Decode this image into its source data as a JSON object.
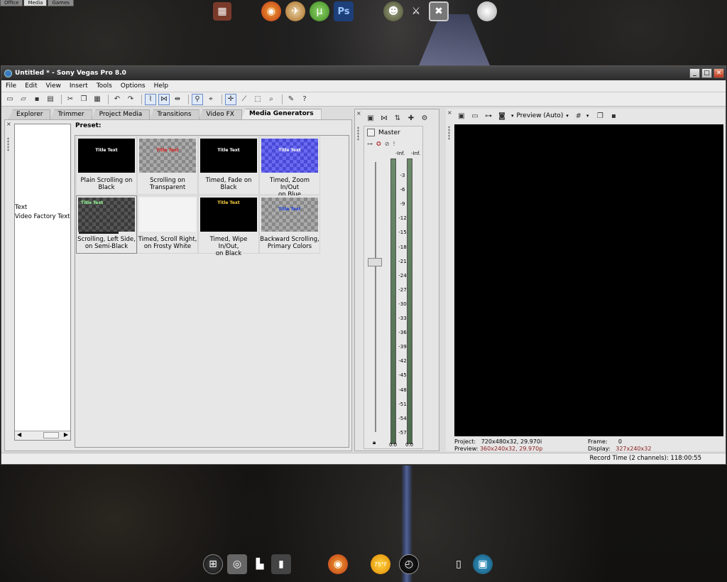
{
  "desktop": {
    "top_tabs": [
      "Office",
      "Media",
      "Games"
    ],
    "active_top_tab": "Media",
    "top_dock_icons": [
      "paint-icon",
      "firefox-icon",
      "ftp-icon",
      "utorrent-icon",
      "photoshop-icon",
      "halo-icon",
      "sword-icon",
      "x-game-icon",
      "moon-icon"
    ],
    "bottom_dock_icons": [
      "windows-start-icon",
      "webcam-icon",
      "boot-icon",
      "pc-icon",
      "firefox-icon",
      "weather-icon",
      "clock-icon",
      "phone-icon",
      "monitor-icon"
    ],
    "weather_temp": "75°F"
  },
  "window": {
    "title": "Untitled * - Sony Vegas Pro 8.0",
    "minimize": "_",
    "maximize": "□",
    "close": "✕"
  },
  "menu": [
    "File",
    "Edit",
    "View",
    "Insert",
    "Tools",
    "Options",
    "Help"
  ],
  "left_panel": {
    "tabs": [
      "Explorer",
      "Trimmer",
      "Project Media",
      "Transitions",
      "Video FX",
      "Media Generators"
    ],
    "active_tab": "Media Generators",
    "tree_items": [
      "Text",
      "Video Factory Text"
    ],
    "preset_label": "Preset:",
    "presets": [
      {
        "label_line1": "Plain Scrolling on",
        "label_line2": "Black",
        "thumb_text": "Title Text",
        "style": "black"
      },
      {
        "label_line1": "Scrolling on",
        "label_line2": "Transparent",
        "thumb_text": "Title Text",
        "style": "checker"
      },
      {
        "label_line1": "Timed, Fade on",
        "label_line2": "Black",
        "thumb_text": "Title Text",
        "style": "black"
      },
      {
        "label_line1": "Timed, Zoom In/Out",
        "label_line2": "on Blue",
        "thumb_text": "Title Text",
        "style": "blue"
      },
      {
        "label_line1": "Scrolling, Left Side,",
        "label_line2": "on Semi-Black",
        "thumb_text": "Title Text",
        "style": "darkcheck"
      },
      {
        "label_line1": "Timed, Scroll Right,",
        "label_line2": "on Frosty White",
        "thumb_text": "",
        "style": "white"
      },
      {
        "label_line1": "Timed, Wipe In/Out,",
        "label_line2": "on Black",
        "thumb_text": "Title Text",
        "style": "black"
      },
      {
        "label_line1": "Backward Scrolling,",
        "label_line2": "Primary Colors",
        "thumb_text": "Title Text",
        "style": "checker"
      }
    ]
  },
  "mixer": {
    "bus_name": "Master",
    "peak_left": "-Inf.",
    "peak_right": "-Inf.",
    "scale": [
      "3",
      "6",
      "9",
      "12",
      "15",
      "18",
      "21",
      "24",
      "27",
      "30",
      "33",
      "36",
      "39",
      "42",
      "45",
      "48",
      "51",
      "54",
      "57"
    ],
    "level_left": "0.0",
    "level_right": "0.0"
  },
  "preview": {
    "mode": "Preview (Auto)",
    "project_label": "Project:",
    "project_value": "720x480x32, 29.970i",
    "preview_label": "Preview:",
    "preview_value": "360x240x32, 29.970p",
    "frame_label": "Frame:",
    "frame_value": "0",
    "display_label": "Display:",
    "display_value": "327x240x32"
  },
  "status": {
    "record_time": "Record Time (2 channels): 118:00:55"
  },
  "colors": {
    "accent_red": "#8b1a1a",
    "selection_blue": "#6a8cc8"
  }
}
